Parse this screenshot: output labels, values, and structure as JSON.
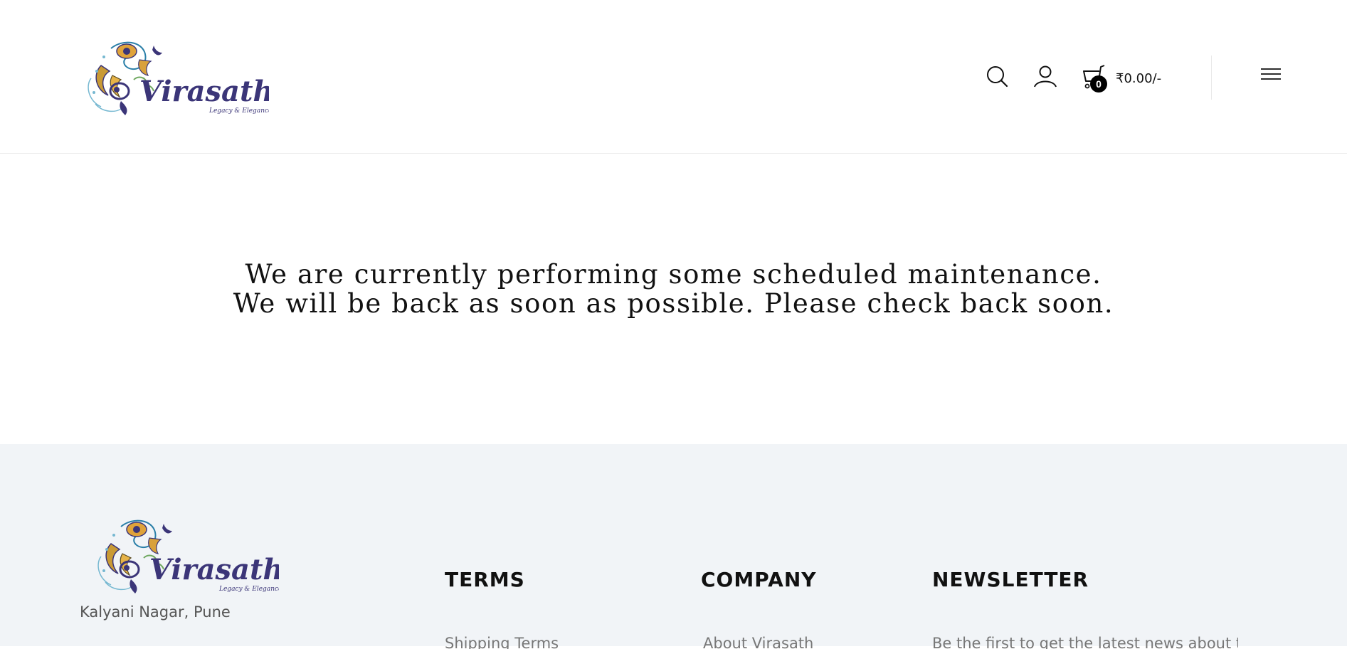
{
  "brand": {
    "name": "Virasath",
    "tagline": "Legacy & Elegance",
    "colors": {
      "primary": "#3b3578",
      "footer_bg": "#f1f4f7"
    }
  },
  "header": {
    "icons": {
      "search": "search-icon",
      "account": "user-icon",
      "cart": "cart-icon",
      "menu": "hamburger-menu-icon"
    },
    "cart": {
      "count": "0",
      "total": "₹0.00/-"
    }
  },
  "main": {
    "message_line1": "We are currently performing some scheduled maintenance.",
    "message_line2": "We will be back as soon as possible. Please check back soon."
  },
  "footer": {
    "address": "Kalyani Nagar, Pune",
    "columns": [
      {
        "heading": "TERMS",
        "first_item": "Shipping Terms"
      },
      {
        "heading": "COMPANY",
        "first_item": "About Virasath"
      },
      {
        "heading": "NEWSLETTER",
        "first_item": "Be the first to get the latest news about trends"
      }
    ]
  }
}
